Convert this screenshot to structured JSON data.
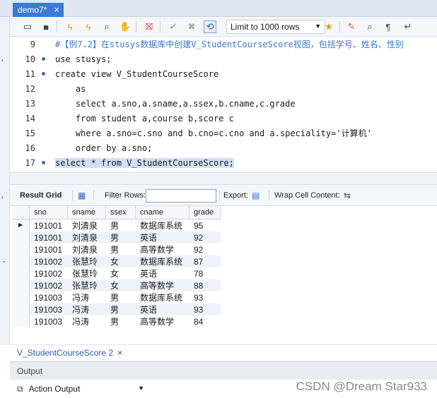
{
  "tab": {
    "title": "demo7*",
    "close": "×"
  },
  "toolbar": {
    "limit_label": "Limit to 1000 rows"
  },
  "editor": {
    "lines": [
      {
        "num": "9",
        "dot": false,
        "text": "#【例7.2】在stusys数据库中创建V_StudentCourseScore视图，包括学号、姓名、性别",
        "kind": "comment"
      },
      {
        "num": "10",
        "dot": true,
        "text": "use stusys;",
        "kind": "code"
      },
      {
        "num": "11",
        "dot": true,
        "text": "create view V_StudentCourseScore",
        "kind": "code"
      },
      {
        "num": "12",
        "dot": false,
        "text": "    as",
        "kind": "code"
      },
      {
        "num": "13",
        "dot": false,
        "text": "    select a.sno,a.sname,a.ssex,b.cname,c.grade",
        "kind": "code"
      },
      {
        "num": "14",
        "dot": false,
        "text": "    from student a,course b,score c",
        "kind": "code"
      },
      {
        "num": "15",
        "dot": false,
        "text": "    where a.sno=c.sno and b.cno=c.cno and a.speciality='计算机'",
        "kind": "code"
      },
      {
        "num": "16",
        "dot": false,
        "text": "    order by a.sno;",
        "kind": "code"
      },
      {
        "num": "17",
        "dot": true,
        "text": "select * from V_StudentCourseScore;",
        "kind": "selected"
      }
    ]
  },
  "result_toolbar": {
    "result_grid": "Result Grid",
    "filter_rows": "Filter Rows:",
    "filter_value": "",
    "export": "Export:",
    "wrap": "Wrap Cell Content:"
  },
  "grid": {
    "columns": [
      "sno",
      "sname",
      "ssex",
      "cname",
      "grade"
    ],
    "rows": [
      [
        "191001",
        "刘清泉",
        "男",
        "数据库系统",
        "95"
      ],
      [
        "191001",
        "刘清泉",
        "男",
        "英语",
        "92"
      ],
      [
        "191001",
        "刘清泉",
        "男",
        "高等数学",
        "92"
      ],
      [
        "191002",
        "张慧玲",
        "女",
        "数据库系统",
        "87"
      ],
      [
        "191002",
        "张慧玲",
        "女",
        "英语",
        "78"
      ],
      [
        "191002",
        "张慧玲",
        "女",
        "高等数学",
        "88"
      ],
      [
        "191003",
        "冯涛",
        "男",
        "数据库系统",
        "93"
      ],
      [
        "191003",
        "冯涛",
        "男",
        "英语",
        "93"
      ],
      [
        "191003",
        "冯涛",
        "男",
        "高等数学",
        "84"
      ]
    ]
  },
  "result_tab": {
    "label": "V_StudentCourseScore 2",
    "close": "×"
  },
  "output": {
    "title": "Output",
    "selector": "Action Output"
  },
  "watermark": "CSDN @Dream Star933"
}
